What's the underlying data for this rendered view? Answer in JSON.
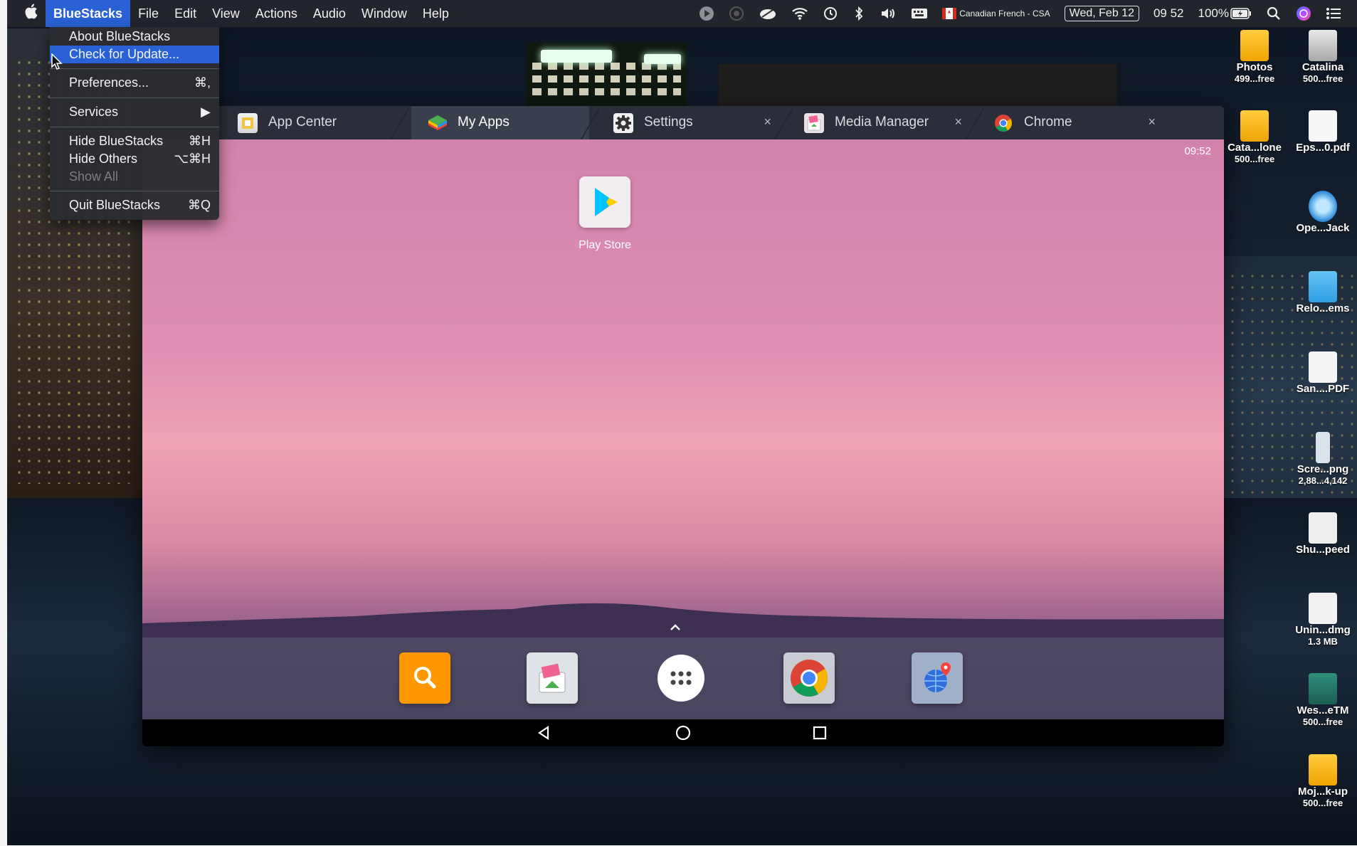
{
  "menubar": {
    "app_name": "BlueStacks",
    "menus": [
      "File",
      "Edit",
      "View",
      "Actions",
      "Audio",
      "Window",
      "Help"
    ],
    "status": {
      "input_source": "Canadian French - CSA",
      "date": "Wed, Feb 12",
      "time": "09 52",
      "battery": "100%"
    }
  },
  "dropdown": {
    "items": [
      {
        "label": "About BlueStacks",
        "shortcut": ""
      },
      {
        "label": "Check for Update...",
        "shortcut": ""
      },
      {
        "label": "Preferences...",
        "shortcut": "⌘,"
      },
      {
        "label": "Services",
        "shortcut": "▶"
      },
      {
        "label": "Hide BlueStacks",
        "shortcut": "⌘H"
      },
      {
        "label": "Hide Others",
        "shortcut": "⌥⌘H"
      },
      {
        "label": "Show All",
        "shortcut": ""
      },
      {
        "label": "Quit BlueStacks",
        "shortcut": "⌘Q"
      }
    ]
  },
  "window": {
    "tabs": [
      {
        "label": "App Center"
      },
      {
        "label": "My Apps"
      },
      {
        "label": "Settings"
      },
      {
        "label": "Media Manager"
      },
      {
        "label": "Chrome"
      }
    ],
    "close_glyph": "×",
    "android_time": "09:52",
    "playstore_label": "Play Store",
    "colors": {
      "tabbar": "#2a2e39",
      "accent": "#2a62d6"
    }
  },
  "desktop_icons": [
    {
      "name": "Photos",
      "sub": "499...free"
    },
    {
      "name": "Catalina",
      "sub": "500...free"
    },
    {
      "name": "Cata...lone",
      "sub": "500...free"
    },
    {
      "name": "Eps...0.pdf",
      "sub": ""
    },
    {
      "name": "Ope...Jack",
      "sub": ""
    },
    {
      "name": "Relo...ems",
      "sub": ""
    },
    {
      "name": "San....PDF",
      "sub": ""
    },
    {
      "name": "Scre...png",
      "sub": "2,88...4,142"
    },
    {
      "name": "Shu...peed",
      "sub": ""
    },
    {
      "name": "Unin...dmg",
      "sub": "1.3 MB"
    },
    {
      "name": "Wes...eTM",
      "sub": "500...free"
    },
    {
      "name": "Moj...k-up",
      "sub": "500...free"
    }
  ]
}
